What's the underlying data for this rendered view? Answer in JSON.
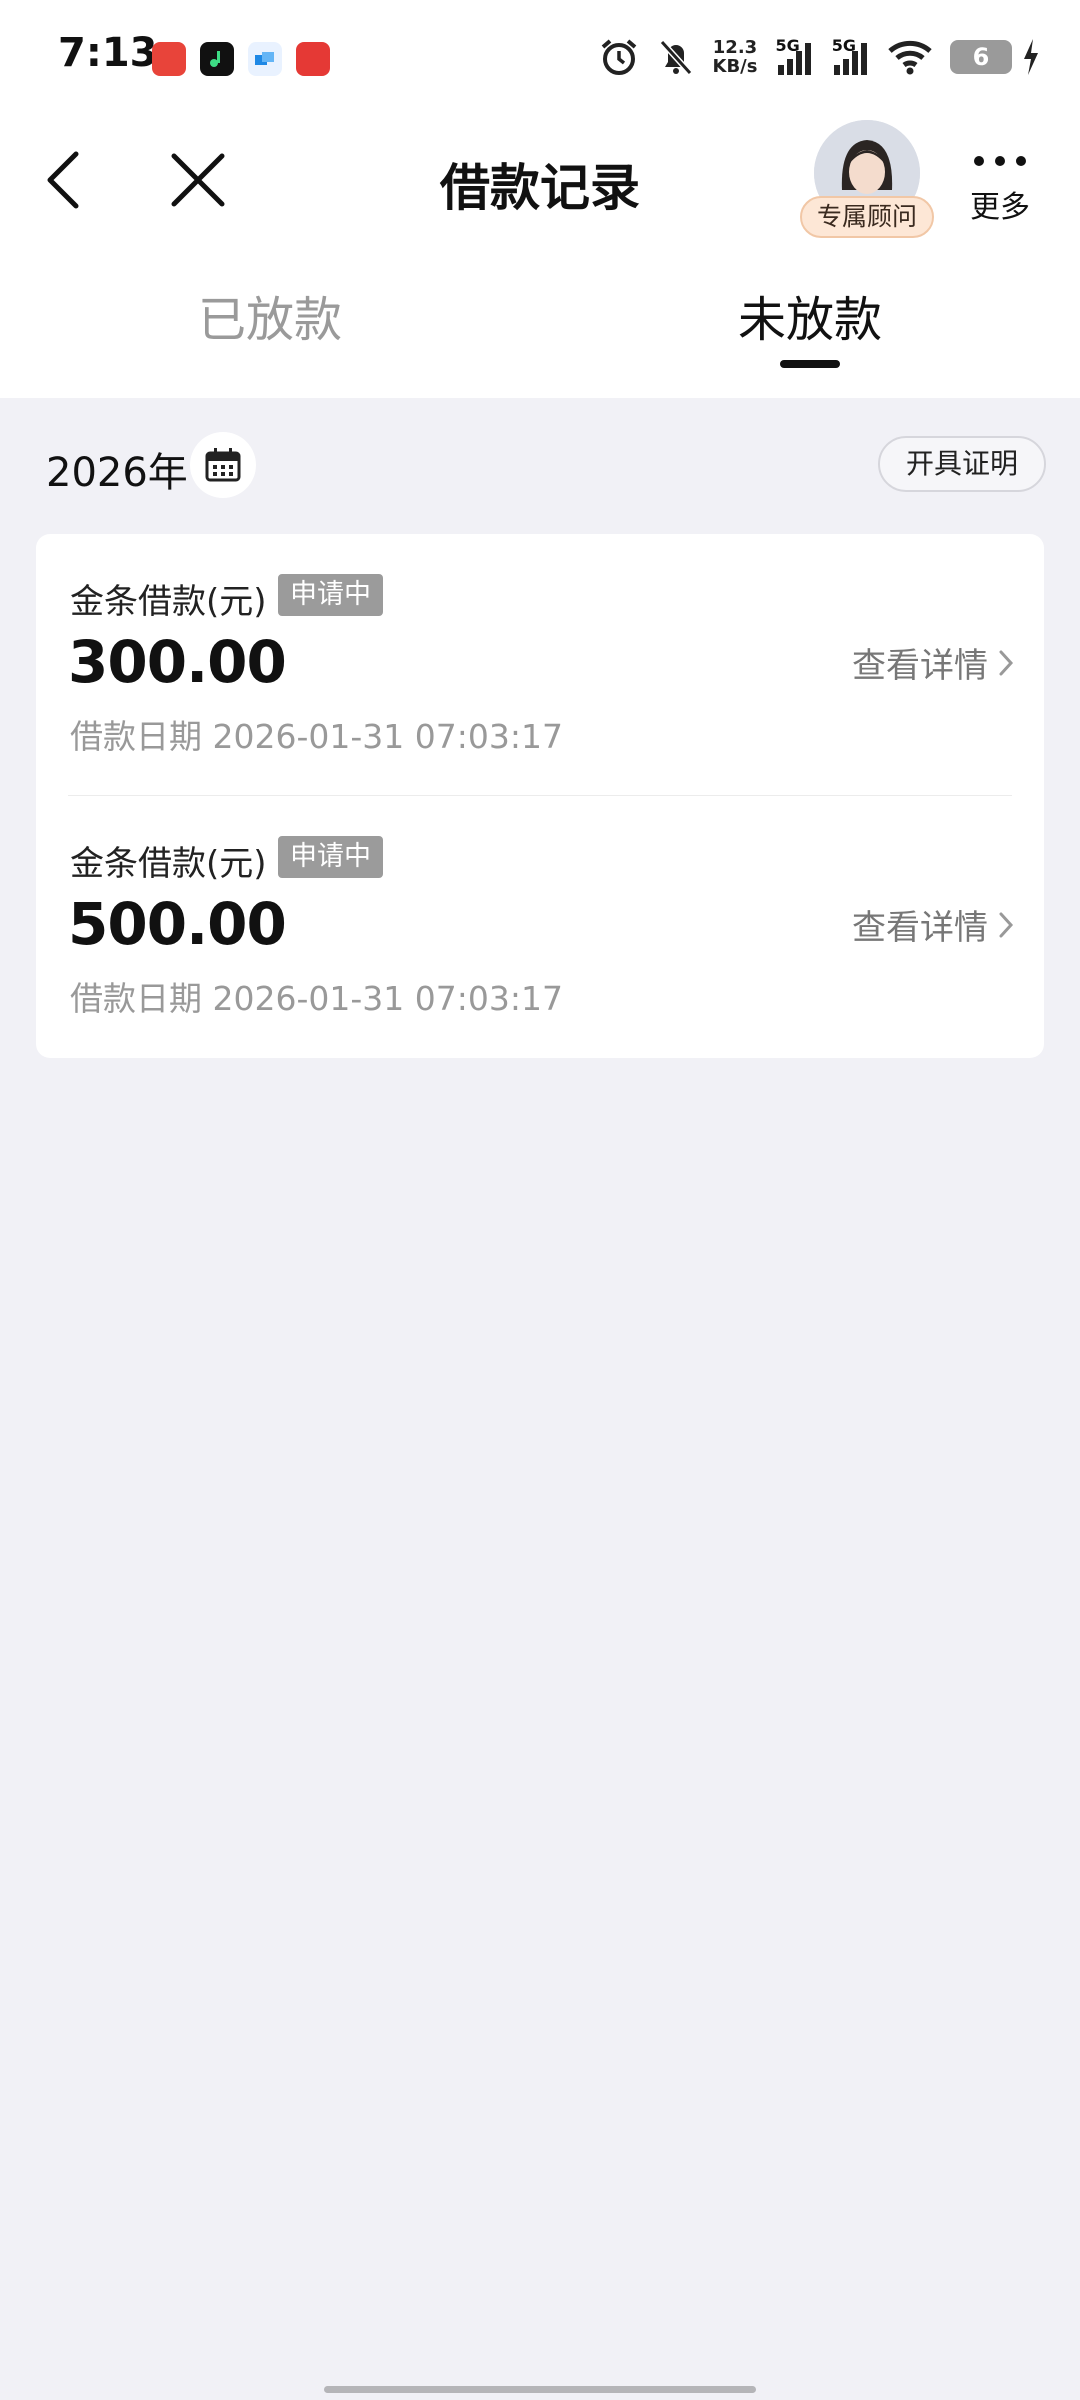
{
  "status": {
    "time": "7:13",
    "net_speed_value": "12.3",
    "net_speed_unit": "KB/s",
    "network_1": "5G",
    "network_2": "5G",
    "battery": "6"
  },
  "header": {
    "title": "借款记录",
    "advisor_label": "专属顾问",
    "more_label": "更多"
  },
  "tabs": [
    {
      "label": "已放款",
      "active": false
    },
    {
      "label": "未放款",
      "active": true
    }
  ],
  "filter": {
    "year": "2026年",
    "cert_button": "开具证明"
  },
  "records": [
    {
      "type_label": "金条借款(元)",
      "status": "申请中",
      "amount": "300.00",
      "date": "借款日期 2026-01-31 07:03:17",
      "detail_label": "查看详情"
    },
    {
      "type_label": "金条借款(元)",
      "status": "申请中",
      "amount": "500.00",
      "date": "借款日期 2026-01-31 07:03:17",
      "detail_label": "查看详情"
    }
  ],
  "colors": {
    "background": "#f1f1f6",
    "badge": "#9b9b9b",
    "advisor_badge": "#fde7d6"
  }
}
